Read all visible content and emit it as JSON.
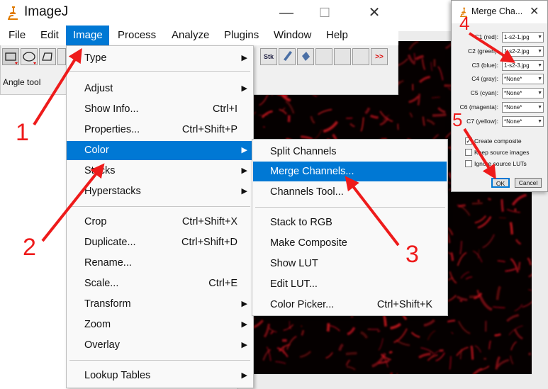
{
  "app": {
    "title": "ImageJ",
    "window_controls": [
      "—",
      "☐",
      "✕"
    ],
    "menubar": [
      "File",
      "Edit",
      "Image",
      "Process",
      "Analyze",
      "Plugins",
      "Window",
      "Help"
    ],
    "active_menu": "Image",
    "toolbar": {
      "stk_label": "Stk",
      "more_label": ">>"
    },
    "status": "Angle tool"
  },
  "image_menu": {
    "items": [
      {
        "label": "Type",
        "shortcut": "",
        "submenu": true
      },
      {
        "label": "Adjust",
        "shortcut": "",
        "submenu": true
      },
      {
        "label": "Show Info...",
        "shortcut": "Ctrl+I",
        "submenu": false
      },
      {
        "label": "Properties...",
        "shortcut": "Ctrl+Shift+P",
        "submenu": false
      },
      {
        "label": "Color",
        "shortcut": "",
        "submenu": true
      },
      {
        "label": "Stacks",
        "shortcut": "",
        "submenu": true
      },
      {
        "label": "Hyperstacks",
        "shortcut": "",
        "submenu": true
      },
      {
        "label": "Crop",
        "shortcut": "Ctrl+Shift+X",
        "submenu": false
      },
      {
        "label": "Duplicate...",
        "shortcut": "Ctrl+Shift+D",
        "submenu": false
      },
      {
        "label": "Rename...",
        "shortcut": "",
        "submenu": false
      },
      {
        "label": "Scale...",
        "shortcut": "Ctrl+E",
        "submenu": false
      },
      {
        "label": "Transform",
        "shortcut": "",
        "submenu": true
      },
      {
        "label": "Zoom",
        "shortcut": "",
        "submenu": true
      },
      {
        "label": "Overlay",
        "shortcut": "",
        "submenu": true
      },
      {
        "label": "Lookup Tables",
        "shortcut": "",
        "submenu": true
      }
    ]
  },
  "color_menu": {
    "items": [
      {
        "label": "Split Channels",
        "shortcut": ""
      },
      {
        "label": "Merge Channels...",
        "shortcut": ""
      },
      {
        "label": "Channels Tool...",
        "shortcut": ""
      },
      {
        "label": "Stack to RGB",
        "shortcut": ""
      },
      {
        "label": "Make Composite",
        "shortcut": ""
      },
      {
        "label": "Show LUT",
        "shortcut": ""
      },
      {
        "label": "Edit LUT...",
        "shortcut": ""
      },
      {
        "label": "Color Picker...",
        "shortcut": "Ctrl+Shift+K"
      }
    ]
  },
  "merge_dialog": {
    "title": "Merge Cha...",
    "close": "✕",
    "channels": [
      {
        "label": "C1 (red):",
        "value": "1-s2-1.jpg"
      },
      {
        "label": "C2 (green):",
        "value": "1-s2-2.jpg"
      },
      {
        "label": "C3 (blue):",
        "value": "1-s2-3.jpg"
      },
      {
        "label": "C4 (gray):",
        "value": "*None*"
      },
      {
        "label": "C5 (cyan):",
        "value": "*None*"
      },
      {
        "label": "C6 (magenta):",
        "value": "*None*"
      },
      {
        "label": "C7 (yellow):",
        "value": "*None*"
      }
    ],
    "options": [
      {
        "label": "Create composite",
        "checked": true
      },
      {
        "label": "Keep source images",
        "checked": false
      },
      {
        "label": "Ignore source LUTs",
        "checked": false
      }
    ],
    "ok_label": "OK",
    "cancel_label": "Cancel"
  },
  "annotations": [
    "1",
    "2",
    "3",
    "4",
    "5"
  ],
  "colors": {
    "accent": "#0078d4",
    "annotation": "#ee1b1b",
    "image_signal": "#c8141e"
  }
}
